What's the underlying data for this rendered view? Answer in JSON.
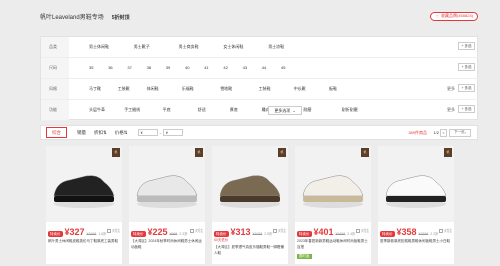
{
  "header": {
    "title": "帆叶Leaveland男鞋专场",
    "count": "5折封顶",
    "fav": "收藏品牌(455824)"
  },
  "filters": [
    {
      "label": "品类",
      "values": [
        "男士休闲鞋",
        "男士靴子",
        "男士商务鞋",
        "女士休闲鞋",
        "男士凉鞋"
      ],
      "more": "",
      "multi": "+ 多选"
    },
    {
      "label": "尺码",
      "values": [
        "35",
        "36",
        "37",
        "38",
        "39",
        "40",
        "41",
        "42",
        "43",
        "44",
        "45"
      ],
      "more": "",
      "multi": "+ 多选"
    },
    {
      "label": "风格",
      "values": [
        "马丁靴",
        "工装靴",
        "休闲鞋",
        "乐福鞋",
        "雪地靴",
        "工装鞋",
        "中长靴",
        "板鞋"
      ],
      "more": "更多",
      "multi": "+ 多选"
    },
    {
      "label": "功能",
      "values": [
        "头层牛革",
        "手工缝线",
        "平底",
        "舒适",
        "厚底",
        "雕花",
        "耐磨",
        "耐折耐磨"
      ],
      "more": "更多",
      "multi": "+ 多选"
    }
  ],
  "more_options": "更多选项",
  "sort": {
    "items": [
      "综合",
      "销量",
      "折扣",
      "价格"
    ],
    "price_from": "¥",
    "price_to": "¥",
    "count_prefix": "",
    "count": "389件商品",
    "page": "1/2",
    "prev": "<",
    "next": "下一页"
  },
  "products": [
    {
      "tag": "特卖价",
      "price": "¥327",
      "orig": "¥1998",
      "discount": "1.6折",
      "desc": "帆叶男士休闲鞋皮鞋英伦马丁鞋厚底工装男鞋",
      "sub": "",
      "promo": ""
    },
    {
      "tag": "特卖价",
      "price": "¥225",
      "orig": "¥998",
      "discount": "2.3折",
      "desc": "【大湾区】2024年秋季时尚休闲鞋男士休闲运动板鞋",
      "sub": "",
      "promo": ""
    },
    {
      "tag": "特卖价",
      "price": "¥313",
      "orig": "¥1098",
      "discount": "2.8折",
      "desc": "【大湾区】夏季透气真皮乐福鞋男鞋一脚蹬懒人鞋",
      "sub": "60天低价",
      "promo": ""
    },
    {
      "tag": "特卖价",
      "price": "¥401",
      "orig": "¥1698",
      "discount": "2.4折",
      "desc": "2023年春夏新款男鞋运动鞋休闲时尚板鞋男士百搭",
      "sub": "",
      "promo": "限时返"
    },
    {
      "tag": "特卖价",
      "price": "¥358",
      "orig": "¥1598",
      "discount": "2.2折",
      "desc": "夏季新款厚底松糕鞋男鞋休闲板鞋男士小白鞋",
      "sub": "",
      "promo": ""
    }
  ],
  "compare_label": "对比"
}
